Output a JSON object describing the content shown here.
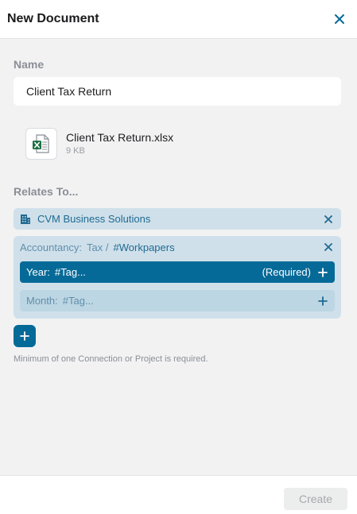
{
  "header": {
    "title": "New Document"
  },
  "name_section": {
    "label": "Name",
    "value": "Client Tax Return"
  },
  "file": {
    "name": "Client Tax Return.xlsx",
    "size": "9 KB"
  },
  "relates_section": {
    "label": "Relates To...",
    "connection": "CVM Business Solutions",
    "group": {
      "crumb_category": "Accountancy:",
      "crumb_parent": "Tax /",
      "crumb_current": "#Workpapers",
      "rows": [
        {
          "label": "Year:",
          "placeholder": "#Tag...",
          "required": "(Required)"
        },
        {
          "label": "Month:",
          "placeholder": "#Tag..."
        }
      ]
    }
  },
  "hint": "Minimum of one Connection or Project is required.",
  "footer": {
    "create_label": "Create"
  },
  "colors": {
    "accent": "#066a98",
    "chip_bg": "#cfe0ea",
    "chip_text": "#1f6a92",
    "excel_green": "#1e7145"
  }
}
